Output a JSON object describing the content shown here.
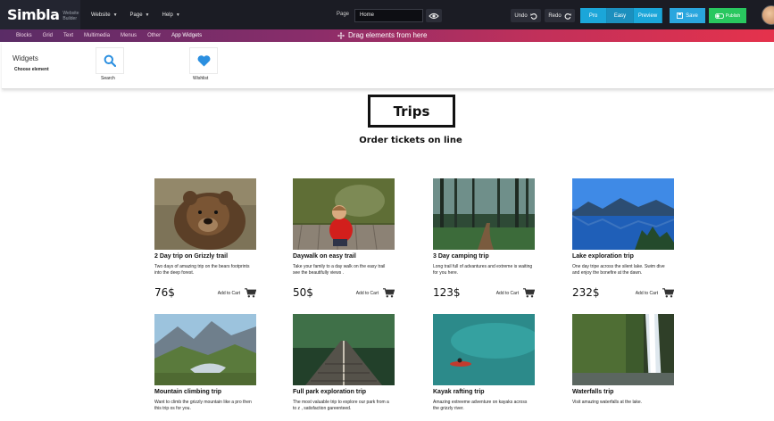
{
  "app": {
    "logo": "Simbla",
    "logo_sub": "Website Builder"
  },
  "topmenu": [
    {
      "label": "Website"
    },
    {
      "label": "Page"
    },
    {
      "label": "Help"
    }
  ],
  "page_selector": {
    "label": "Page",
    "value": "Home"
  },
  "actions": {
    "undo": "Undo",
    "redo": "Redo",
    "pro": "Pro",
    "easy": "Easy",
    "preview": "Preview",
    "save": "Save",
    "publish": "Publish"
  },
  "tabs": [
    {
      "label": "Blocks"
    },
    {
      "label": "Grid"
    },
    {
      "label": "Text"
    },
    {
      "label": "Multimedia"
    },
    {
      "label": "Menus"
    },
    {
      "label": "Other"
    },
    {
      "label": "App Widgets"
    }
  ],
  "drag_hint": "Drag elements from here",
  "widgets_panel": {
    "title": "Widgets",
    "subtitle": "Choose element",
    "items": [
      {
        "label": "Search",
        "icon": "search-icon"
      },
      {
        "label": "Wishlist",
        "icon": "heart-icon"
      }
    ]
  },
  "colors": {
    "accent_blue": "#1ba6d9",
    "publish_green": "#29c75f",
    "heart_blue": "#2b8fe0"
  },
  "content": {
    "title": "Trips",
    "subtitle": "Order tickets on line",
    "add_to_cart": "Add to Cart",
    "trips": [
      {
        "title": "2 Day trip on Grizzly trail",
        "desc": "Two days of amazing trip on the bears footprints into the deep forest.",
        "price": "76$"
      },
      {
        "title": "Daywalk on easy trail",
        "desc": "Take your family to a day walk on the easy trail see the beautifully views .",
        "price": "50$"
      },
      {
        "title": "3 Day camping trip",
        "desc": "Long trail full of advantures and extreme is waiting for you here.",
        "price": "123$"
      },
      {
        "title": "Lake exploration trip",
        "desc": "One day tripe across the silent lake. Swim dive and enjoy the bonefire at the dawn.",
        "price": "232$"
      },
      {
        "title": "Mountain climbing trip",
        "desc": "Want to climb the grizzly mountain like a pro then this trip os for you.",
        "price": ""
      },
      {
        "title": "Full park exploration trip",
        "desc": "The most valuable trip to explore our park from a to z , satisfaction gareenteed.",
        "price": ""
      },
      {
        "title": "Kayak rafting trip",
        "desc": "Amazing extreeme adventure on kayaks across the grizzly river.",
        "price": ""
      },
      {
        "title": "Waterfalls trip",
        "desc": "Visit amazing waterfalls at the lake.",
        "price": ""
      }
    ]
  }
}
